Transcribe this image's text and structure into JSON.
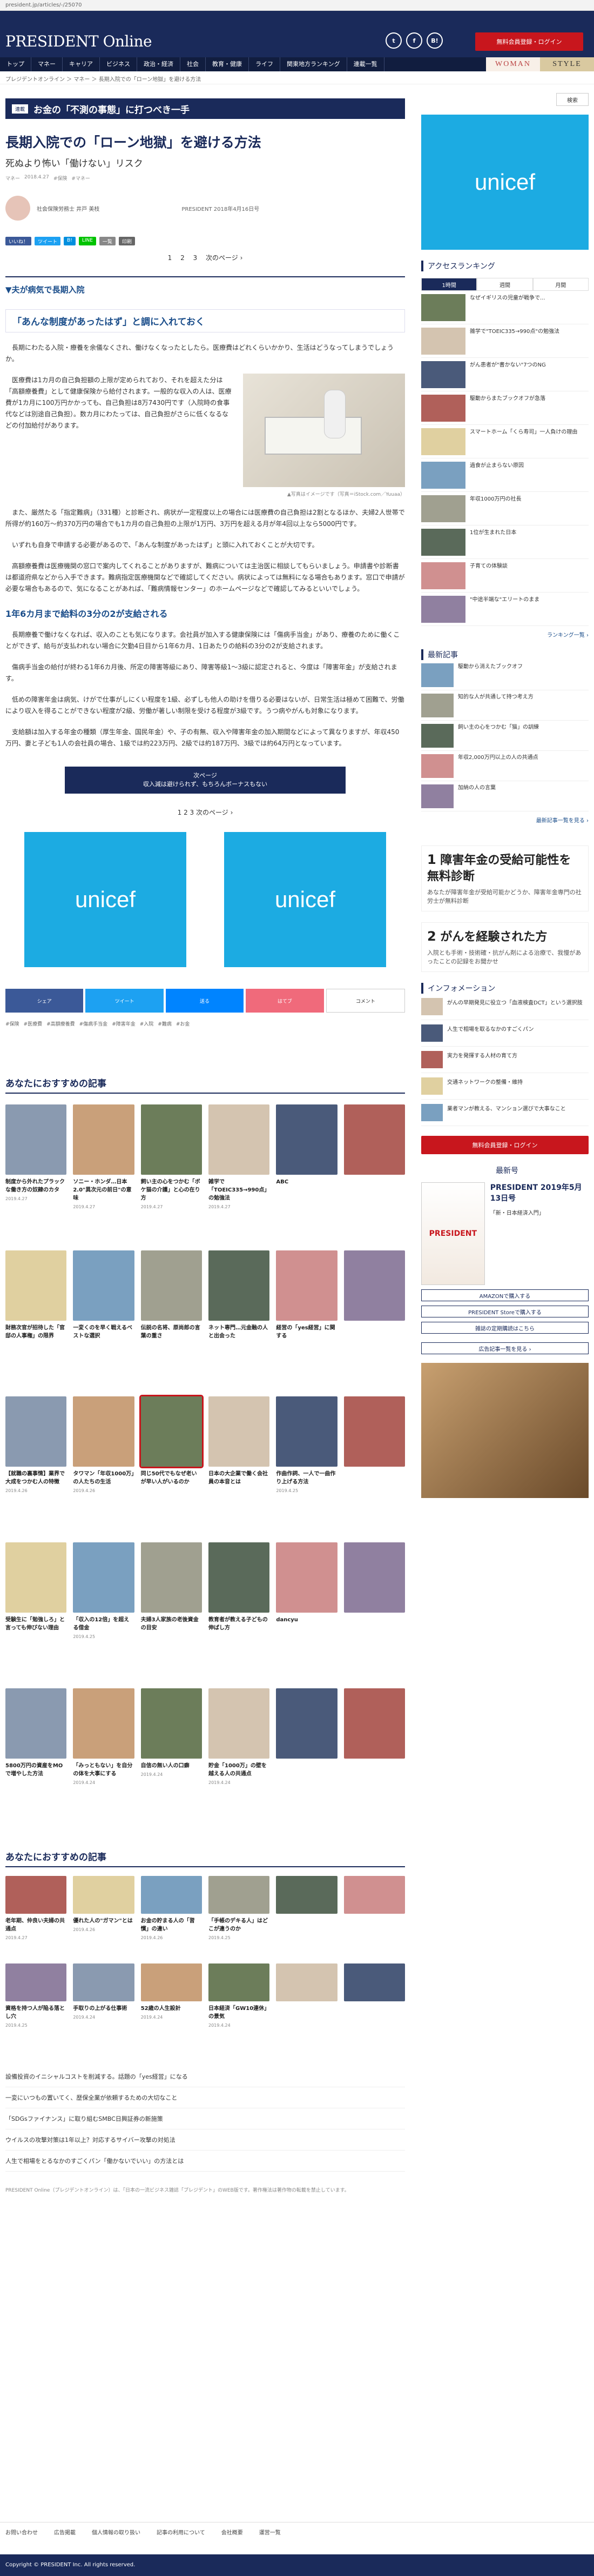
{
  "url": "president.jp/articles/-/25070",
  "header": {
    "logo": "PRESIDENT Online",
    "register": "無料会員登録・ログイン"
  },
  "social": [
    "t",
    "f",
    "B!"
  ],
  "nav": [
    "トップ",
    "マネー",
    "キャリア",
    "ビジネス",
    "政治・経済",
    "社会",
    "教育・健康",
    "ライフ",
    "関東地方ランキング",
    "連載一覧"
  ],
  "woman": "WOMAN",
  "style": "STYLE",
  "breadcrumb": "プレジデントオンライン ＞ マネー ＞ 長期入院での「ローン地獄」を避ける方法",
  "campaign": {
    "tag": "連載",
    "title": "お金の「不測の事態」に打つべき一手"
  },
  "article": {
    "title": "長期入院での「ローン地獄」を避ける方法",
    "subtitle": "死ぬより怖い「働けない」リスク",
    "meta": [
      "マネー",
      "2018.4.27",
      "#保険",
      "#マネー"
    ],
    "author": "社会保険労務士 井戸 美枝",
    "pub": "PRESIDENT 2018年4月16日号",
    "share": [
      "いいね！",
      "ツイート",
      "B!",
      "LINE",
      "一覧",
      "印刷"
    ],
    "pager": [
      "1",
      "2",
      "3",
      "次のページ ›"
    ],
    "section1": "▼夫が病気で長期入院",
    "q": "「あんな制度があったはず」と調に入れておく",
    "p1": "長期にわたる入院・療養を余儀なくされ、働けなくなったとしたら。医療費はどれくらいかかり、生活はどうなってしまうでしょうか。",
    "p2": "医療費は1カ月の自己負担額の上限が定められており、それを超えた分は「高額療養費」として健康保険から給付されます。一般的な収入の人は、医療費が1カ月に100万円かかっても、自己負担は8万7430円です（入院時の食事代などは別途自己負担）。数カ月にわたっては、自己負担がさらに低くなるなどの付加給付があります。",
    "p3": "また、厳然たる「指定難病」（331種）と診断され、病状が一定程度以上の場合には医療費の自己負担は2割となるほか、夫婦2人世帯で所得が約160万〜約370万円の場合でも1カ月の自己負担の上限が1万円、3万円を超える月が年4回以上なら5000円です。",
    "p4": "いずれも自身で申請する必要があるので、「あんな制度があったはず」と頭に入れておくことが大切です。",
    "p5": "高額療養費は医療機関の窓口で案内してくれることがありますが、難病については主治医に相談してもらいましょう。申請書や診断書は都道府県などから入手できます。難病指定医療機関などで確認してください。病状によっては無料になる場合もあります。窓口で申請が必要な場合もあるので、気になることがあれば、「難病情報センター」のホームページなどで確認してみるといいでしょう。",
    "photo_caption": "▲写真はイメージです（写真＝iStock.com／Yuuaa）",
    "h2": "1年6カ月まで給料の3分の2が支給される",
    "p6": "長期療養で働けなくなれば、収入のことも気になります。会社員が加入する健康保険には「傷病手当金」があり、療養のために働くことができず、給与が支払われない場合に欠勤4日目から1年6カ月、1日あたりの給料の3分の2が支給されます。",
    "p7": "傷病手当金の給付が終わる1年6カ月後、所定の障害等級にあり、障害等級1〜3級に認定されると、今度は「障害年金」が支給されます。",
    "p8": "低めの障害年金は病気、けがで仕事がしにくい程度を1級、必ずしも他人の助けを借りる必要はないが、日常生活は極めて困難で、労働により収入を得ることができない程度が2級、労働が著しい制限を受ける程度が3級です。うつ病やがんも対象になります。",
    "p9": "支給額は加入する年金の種類（厚生年金、国民年金）や、子の有無、収入や障害年金の加入期間などによって異なりますが、年収450万円、妻と子ども1人の会社員の場合、1級では約223万円、2級では約187万円、3級では約64万円となっています。",
    "next_label": "次ページ",
    "next_title": "収入減は避けられず、もちろんボーナスもない",
    "bottom_share": [
      "シェア",
      "ツイート",
      "送る",
      "はてブ",
      "コメント"
    ],
    "tags": [
      "#保険",
      "#医療費",
      "#高額療養費",
      "#傷病手当金",
      "#障害年金",
      "#入院",
      "#難病",
      "#お金"
    ]
  },
  "ad_unicef": "unicef",
  "recommend": {
    "title": "あなたにおすすめの記事",
    "cards": [
      {
        "title": "制度から外れたプラックな働き方の奴隷のカタ",
        "date": "2019.4.27"
      },
      {
        "title": "ソニー・ホンダ…日本2.0\"異次元の前日\"の意味",
        "date": "2019.4.27"
      },
      {
        "title": "飼い主の心をつかむ「ボケ猫の介護」と心の在り方",
        "date": "2019.4.27"
      },
      {
        "title": "雑学で「TOEIC335→990点」の勉強法",
        "date": "2019.4.27"
      },
      {
        "title": "ABC",
        "date": ""
      },
      {
        "title": "",
        "date": ""
      },
      {
        "title": "財務次官が招待した「官邸の人事権」の限界",
        "date": ""
      },
      {
        "title": "一変くのを早く戦えるベストな選択",
        "date": ""
      },
      {
        "title": "伝説の名将、原尚郎の言葉の重さ",
        "date": ""
      },
      {
        "title": "ネット専門…元金融の人と出会った",
        "date": ""
      },
      {
        "title": "経営の「yes経営」に関する",
        "date": ""
      },
      {
        "title": "",
        "date": ""
      },
      {
        "title": "【就職の裏事情】業界で大成をつかむ人の特徴",
        "date": "2019.4.26"
      },
      {
        "title": "タワマン「年収1000万」の人たちの生活",
        "date": "2019.4.26"
      },
      {
        "title": "同じ50代でもなぜ老いが早い人がいるのか",
        "date": ""
      },
      {
        "title": "日本の大企業で働く会社員の本音とは",
        "date": ""
      },
      {
        "title": "作曲作詞、一人で一曲作り上げる方法",
        "date": "2019.4.25"
      },
      {
        "title": "",
        "date": ""
      },
      {
        "title": "受験生に「勉強しろ」と言っても伸びない理由",
        "date": ""
      },
      {
        "title": "「収入の12倍」を超える借金",
        "date": "2019.4.25"
      },
      {
        "title": "夫婦3人家族の老後資金の目安",
        "date": ""
      },
      {
        "title": "教育者が教える子どもの伸ばし方",
        "date": ""
      },
      {
        "title": "dancyu",
        "date": ""
      },
      {
        "title": "",
        "date": ""
      },
      {
        "title": "5800万円の資産をMOで増やした方法",
        "date": ""
      },
      {
        "title": "「みっともない」を自分の体を大事にする",
        "date": "2019.4.24"
      },
      {
        "title": "自信の無い人の口癖",
        "date": "2019.4.24"
      },
      {
        "title": "貯金「1000万」の壁を越える人の共通点",
        "date": "2019.4.24"
      },
      {
        "title": "",
        "date": ""
      },
      {
        "title": "",
        "date": ""
      }
    ]
  },
  "recommend2": {
    "title": "あなたにおすすめの記事",
    "cards": [
      {
        "title": "老年期、仲良い夫婦の共通点",
        "date": "2019.4.27"
      },
      {
        "title": "優れた人の\"ガマン\"とは",
        "date": "2019.4.26"
      },
      {
        "title": "お金の貯まる人の「習慣」の違い",
        "date": "2019.4.26"
      },
      {
        "title": "「手帳のデキる人」はどこが違うのか",
        "date": "2019.4.25"
      },
      {
        "title": "",
        "date": ""
      },
      {
        "title": "",
        "date": ""
      },
      {
        "title": "資格を持つ人が陥る落とし穴",
        "date": "2019.4.25"
      },
      {
        "title": "手取りの上がる仕事術",
        "date": "2019.4.24"
      },
      {
        "title": "52歳の人生設計",
        "date": "2019.4.24"
      },
      {
        "title": "日本経済「GW10連休」の景気",
        "date": "2019.4.24"
      },
      {
        "title": "",
        "date": ""
      },
      {
        "title": "",
        "date": ""
      }
    ]
  },
  "links": [
    "設備投資のイニシャルコストを削減する。話題の「yes経営」になる",
    "一変にいつもの置いてく、歴保全業が依頼するための大切なこと",
    "「SDGsファイナンス」に取り組むSMBC日興証券の新施策",
    "ウイルスの攻撃対策は1年以上？対応するサイバー攻撃の対処法",
    "人生で相場をとるなかのすごくパン「働かないでいい」の方法とは"
  ],
  "notice": "PRESIDENT Online（プレジデントオンライン）は、「日本の一流ビジネス雑誌「プレジデント」のWEB版です。著作権法は著作物の転載を禁止しています。",
  "footer_links": [
    "お問い合わせ",
    "広告掲載",
    "個人情報の取り扱い",
    "記事の利用について",
    "会社概要",
    "運営一覧"
  ],
  "copyright": "Copyright © PRESIDENT Inc. All rights reserved.",
  "side": {
    "search": "検索",
    "ranking_title": "アクセスランキング",
    "tabs": [
      "1時間",
      "週間",
      "月間"
    ],
    "ranking": [
      "なぜイギリスの児童が戦争で...",
      "雑学で\"TOEIC335→990点\"の勉強法",
      "がん患者が\"書かない\"7つのNG",
      "駆動からまたブックオフが急落",
      "スマートホーム「くら寿司」一人負けの理由",
      "過食が止まらない原因",
      "年収1000万円の社長",
      "1位が生まれた日本",
      "子育ての体験談",
      "\"中途半端な\"エリートのまま"
    ],
    "ranking_more": "ランキング一覧 ›",
    "news_title": "最新記事",
    "news": [
      "駆動から消えたブックオフ",
      "知的な人が共通して持つ考え方",
      "飼い主の心をつかむ「猫」の訓練",
      "年収2,000万円以上の人の共通点",
      "加納の人の言葉"
    ],
    "news_more": "最新記事一覧を見る ›",
    "ad1": {
      "num": "1",
      "title": "障害年金の受給可能性を無料診断",
      "sub": "あなたが障害年金が受給可能かどうか、障害年金専門の社労士が無料診断"
    },
    "ad2": {
      "num": "2",
      "title": "がんを経験された方",
      "sub": "入院とも手術・技術確・抗がん剤による治療で、我慢があったことの記録をお聞かせ"
    },
    "info_title": "インフォメーション",
    "info": [
      "がんの早期発見に役立つ「血液検査DCT」という選択肢",
      "人生で相場を取るなかのすごくパン",
      "実力を発揮する人材の育て方",
      "交通ネットワークの整備・維持",
      "業者マンが教える、マンション選びで大事なこと"
    ],
    "register": "無料会員登録・ログイン",
    "mag_title": "最新号",
    "mag_cover": "PRESIDENT",
    "mag_desc": "PRESIDENT 2019年5月13日号",
    "mag_sub": "「新・日本経済入門」",
    "mag_buttons": [
      "AMAZONで購入する",
      "PRESIDENT Storeで購入する",
      "雑誌の定期購読はこちら"
    ],
    "mag_back": "広告記事一覧を見る ›"
  }
}
